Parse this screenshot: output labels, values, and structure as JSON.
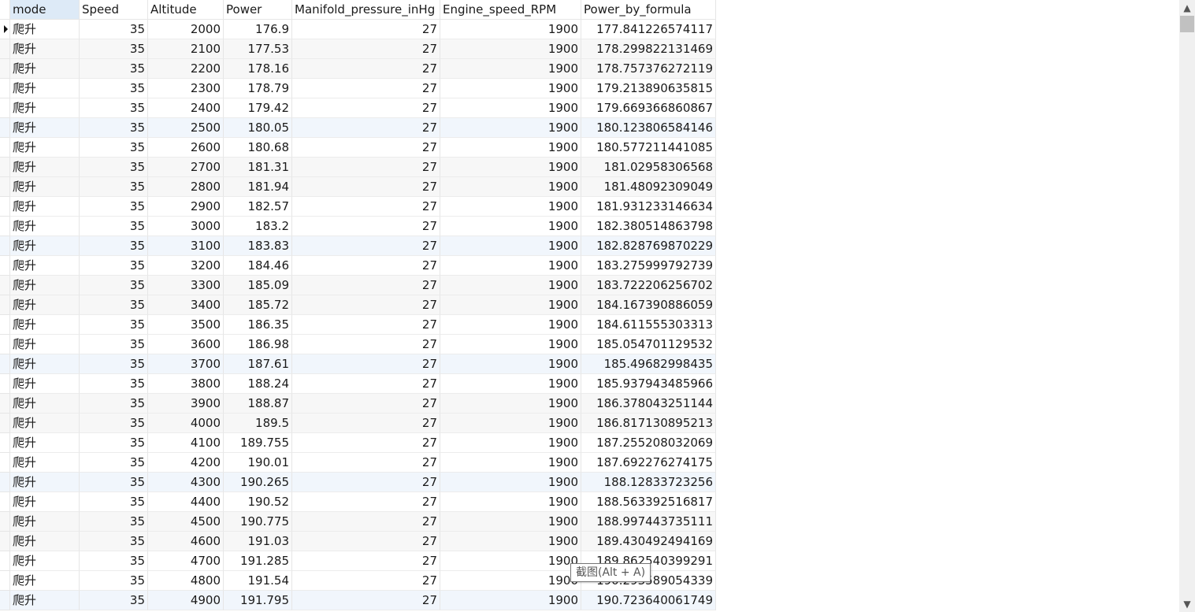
{
  "columns": [
    "mode",
    "Speed",
    "Altitude",
    "Power",
    "Manifold_pressure_inHg",
    "Engine_speed_RPM",
    "Power_by_formula"
  ],
  "rows": [
    [
      "爬升",
      "35",
      "2000",
      "176.9",
      "27",
      "1900",
      "177.841226574117"
    ],
    [
      "爬升",
      "35",
      "2100",
      "177.53",
      "27",
      "1900",
      "178.299822131469"
    ],
    [
      "爬升",
      "35",
      "2200",
      "178.16",
      "27",
      "1900",
      "178.757376272119"
    ],
    [
      "爬升",
      "35",
      "2300",
      "178.79",
      "27",
      "1900",
      "179.213890635815"
    ],
    [
      "爬升",
      "35",
      "2400",
      "179.42",
      "27",
      "1900",
      "179.669366860867"
    ],
    [
      "爬升",
      "35",
      "2500",
      "180.05",
      "27",
      "1900",
      "180.123806584146"
    ],
    [
      "爬升",
      "35",
      "2600",
      "180.68",
      "27",
      "1900",
      "180.577211441085"
    ],
    [
      "爬升",
      "35",
      "2700",
      "181.31",
      "27",
      "1900",
      "181.02958306568"
    ],
    [
      "爬升",
      "35",
      "2800",
      "181.94",
      "27",
      "1900",
      "181.48092309049"
    ],
    [
      "爬升",
      "35",
      "2900",
      "182.57",
      "27",
      "1900",
      "181.931233146634"
    ],
    [
      "爬升",
      "35",
      "3000",
      "183.2",
      "27",
      "1900",
      "182.380514863798"
    ],
    [
      "爬升",
      "35",
      "3100",
      "183.83",
      "27",
      "1900",
      "182.828769870229"
    ],
    [
      "爬升",
      "35",
      "3200",
      "184.46",
      "27",
      "1900",
      "183.275999792739"
    ],
    [
      "爬升",
      "35",
      "3300",
      "185.09",
      "27",
      "1900",
      "183.722206256702"
    ],
    [
      "爬升",
      "35",
      "3400",
      "185.72",
      "27",
      "1900",
      "184.167390886059"
    ],
    [
      "爬升",
      "35",
      "3500",
      "186.35",
      "27",
      "1900",
      "184.611555303313"
    ],
    [
      "爬升",
      "35",
      "3600",
      "186.98",
      "27",
      "1900",
      "185.054701129532"
    ],
    [
      "爬升",
      "35",
      "3700",
      "187.61",
      "27",
      "1900",
      "185.49682998435"
    ],
    [
      "爬升",
      "35",
      "3800",
      "188.24",
      "27",
      "1900",
      "185.937943485966"
    ],
    [
      "爬升",
      "35",
      "3900",
      "188.87",
      "27",
      "1900",
      "186.378043251144"
    ],
    [
      "爬升",
      "35",
      "4000",
      "189.5",
      "27",
      "1900",
      "186.817130895213"
    ],
    [
      "爬升",
      "35",
      "4100",
      "189.755",
      "27",
      "1900",
      "187.255208032069"
    ],
    [
      "爬升",
      "35",
      "4200",
      "190.01",
      "27",
      "1900",
      "187.692276274175"
    ],
    [
      "爬升",
      "35",
      "4300",
      "190.265",
      "27",
      "1900",
      "188.12833723256"
    ],
    [
      "爬升",
      "35",
      "4400",
      "190.52",
      "27",
      "1900",
      "188.563392516817"
    ],
    [
      "爬升",
      "35",
      "4500",
      "190.775",
      "27",
      "1900",
      "188.997443735111"
    ],
    [
      "爬升",
      "35",
      "4600",
      "191.03",
      "27",
      "1900",
      "189.430492494169"
    ],
    [
      "爬升",
      "35",
      "4700",
      "191.285",
      "27",
      "1900",
      "189.862540399291"
    ],
    [
      "爬升",
      "35",
      "4800",
      "191.54",
      "27",
      "1900",
      "190.293589054339"
    ],
    [
      "爬升",
      "35",
      "4900",
      "191.795",
      "27",
      "1900",
      "190.723640061749"
    ]
  ],
  "tooltip": "截图(Alt + A)",
  "icons": {
    "row_indicator": "triangle-right-icon",
    "scroll_up": "chevron-up-icon",
    "scroll_down": "chevron-down-icon"
  }
}
